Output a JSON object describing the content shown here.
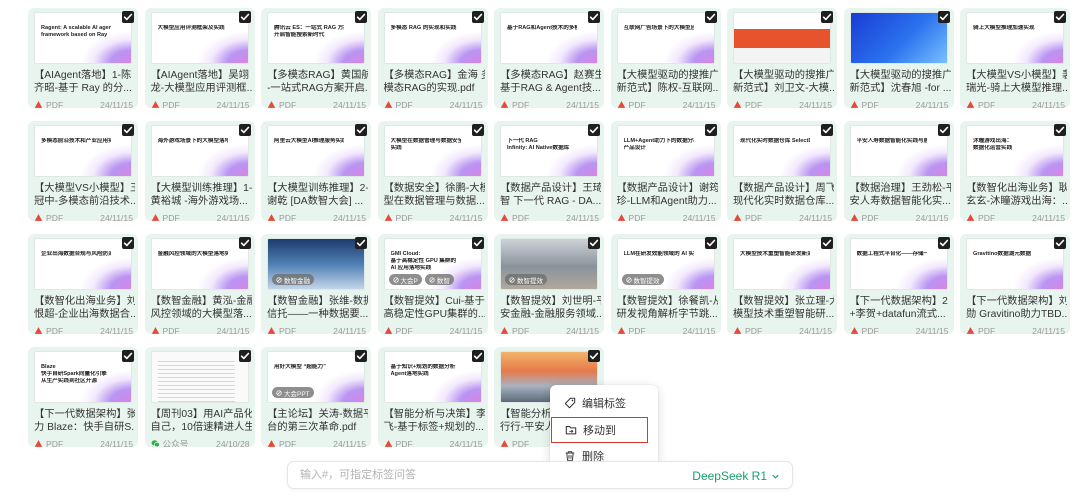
{
  "cards": [
    {
      "lines": [
        "【AIAgent落地】1-陈",
        "齐昭-基于 Ray 的分..."
      ],
      "source": "PDF",
      "source_icon": "pdf-icon",
      "date": "24/11/15",
      "thumb": {
        "tone": "slide",
        "text": [
          "Ragent: A scalable AI agent",
          "framework based on Ray"
        ],
        "tags": []
      }
    },
    {
      "lines": [
        "【AIAgent落地】吴翊",
        "龙-大模型应用评测框..."
      ],
      "source": "PDF",
      "source_icon": "pdf-icon",
      "date": "24/11/15",
      "thumb": {
        "tone": "slide",
        "text": [
          "大模型应用评测框架及实践"
        ],
        "tags": []
      }
    },
    {
      "lines": [
        "【多模态RAG】黄国航",
        "-一站式RAG方案开启..."
      ],
      "source": "PDF",
      "source_icon": "pdf-icon",
      "date": "24/11/15",
      "thumb": {
        "tone": "slide",
        "text": [
          "腾讯云 ES：一站式 RAG 方案",
          "开启智能搜索新时代"
        ],
        "tags": []
      }
    },
    {
      "lines": [
        "【多模态RAG】金海 多",
        "模态RAG的实现.pdf"
      ],
      "source": "PDF",
      "source_icon": "pdf-icon",
      "date": "24/11/15",
      "thumb": {
        "tone": "slide",
        "text": [
          "多模态 RAG 的实现和实践"
        ],
        "tags": []
      }
    },
    {
      "lines": [
        "【多模态RAG】赵赛生",
        "基于RAG & Agent技..."
      ],
      "source": "PDF",
      "source_icon": "pdf-icon",
      "date": "24/11/15",
      "thumb": {
        "tone": "slide",
        "text": [
          "基于RAG和Agent技术的多模态助手实践"
        ],
        "tags": []
      }
    },
    {
      "lines": [
        "【大模型驱动的搜推广",
        "新范式】陈权-互联网..."
      ],
      "source": "PDF",
      "source_icon": "pdf-icon",
      "date": "24/11/15",
      "thumb": {
        "tone": "slide",
        "text": [
          "互联网广告场景下的大模型应用探索与实践"
        ],
        "tags": []
      }
    },
    {
      "lines": [
        "【大模型驱动的搜推广",
        "新范式】刘卫文-大模..."
      ],
      "source": "PDF",
      "source_icon": "pdf-icon",
      "date": "24/11/15",
      "thumb": {
        "tone": "red",
        "text": [],
        "tags": []
      }
    },
    {
      "lines": [
        "【大模型驱动的搜推广",
        "新范式】沈春旭 -for ..."
      ],
      "source": "PDF",
      "source_icon": "pdf-icon",
      "date": "24/11/15",
      "thumb": {
        "tone": "blue",
        "text": [],
        "tags": []
      }
    },
    {
      "lines": [
        "【大模型VS小模型】裴",
        "瑞光-骑上大模型推理..."
      ],
      "source": "PDF",
      "source_icon": "pdf-icon",
      "date": "24/11/15",
      "thumb": {
        "tone": "slide",
        "text": [
          "骑上大模型推理加速实现"
        ],
        "tags": []
      }
    },
    {
      "lines": [
        "【大模型VS小模型】王",
        "冠中-多模态前沿技术..."
      ],
      "source": "PDF",
      "source_icon": "pdf-icon",
      "date": "24/11/15",
      "thumb": {
        "tone": "slide",
        "text": [
          "多模态前沿技术和产业应用实践"
        ],
        "tags": []
      }
    },
    {
      "lines": [
        "【大模型训练推理】1-",
        "黄裕城 -海外游戏场..."
      ],
      "source": "PDF",
      "source_icon": "pdf-icon",
      "date": "24/11/15",
      "thumb": {
        "tone": "slide",
        "text": [
          "海外游戏场景下的大模型落地实践"
        ],
        "tags": []
      }
    },
    {
      "lines": [
        "【大模型训练推理】2-",
        "谢乾 [DA数智大会] ..."
      ],
      "source": "PDF",
      "source_icon": "pdf-icon",
      "date": "24/11/15",
      "thumb": {
        "tone": "slide",
        "text": [
          "阿里云大模型AI推理服务实践"
        ],
        "tags": []
      }
    },
    {
      "lines": [
        "【数据安全】徐鹏-大模",
        "型在数据管理与数据..."
      ],
      "source": "PDF",
      "source_icon": "pdf-icon",
      "date": "24/11/15",
      "thumb": {
        "tone": "slide",
        "text": [
          "大模型在数据管理与数据安全领域的",
          "实践"
        ],
        "tags": []
      }
    },
    {
      "lines": [
        "【数据产品设计】王琦",
        "智 下一代 RAG - DA..."
      ],
      "source": "PDF",
      "source_icon": "pdf-icon",
      "date": "24/11/15",
      "thumb": {
        "tone": "slide",
        "text": [
          "下一代 RAG",
          "Infinity: AI Native数据库"
        ],
        "tags": []
      }
    },
    {
      "lines": [
        "【数据产品设计】谢筠",
        "珍-LLM和Agent助力..."
      ],
      "source": "PDF",
      "source_icon": "pdf-icon",
      "date": "24/11/15",
      "thumb": {
        "tone": "slide",
        "text": [
          "LLM+Agent助力下的数据分析",
          "产品设计"
        ],
        "tags": []
      }
    },
    {
      "lines": [
        "【数据产品设计】周飞-",
        "现代化实时数据仓库..."
      ],
      "source": "PDF",
      "source_icon": "pdf-icon",
      "date": "24/11/15",
      "thumb": {
        "tone": "slide",
        "text": [
          "现代化实时数据仓库 SelectDB"
        ],
        "tags": []
      }
    },
    {
      "lines": [
        "【数据治理】王劲松-平",
        "安人寿数据智能化实..."
      ],
      "source": "PDF",
      "source_icon": "pdf-icon",
      "date": "24/11/15",
      "thumb": {
        "tone": "slide",
        "text": [
          "平安人寿数据智能化实践与展望"
        ],
        "tags": []
      }
    },
    {
      "lines": [
        "【数智化出海业务】耿",
        "玄玄-沐瞳游戏出海：..."
      ],
      "source": "PDF",
      "source_icon": "pdf-icon",
      "date": "24/11/15",
      "thumb": {
        "tone": "slide",
        "text": [
          "沐瞳游戏出海：",
          "数据化运营实践"
        ],
        "tags": []
      }
    },
    {
      "lines": [
        "【数智化出海业务】刘",
        "恨超-企业出海数据合..."
      ],
      "source": "PDF",
      "source_icon": "pdf-icon",
      "date": "24/11/15",
      "thumb": {
        "tone": "slide",
        "text": [
          "企业出海数据合规与风险防范"
        ],
        "tags": []
      }
    },
    {
      "lines": [
        "【数智金融】黄泓-金融",
        "风控领域的大模型落..."
      ],
      "source": "PDF",
      "source_icon": "pdf-icon",
      "date": "24/11/15",
      "thumb": {
        "tone": "slide",
        "text": [
          "金融风控领域的大模型落地实践"
        ],
        "tags": []
      }
    },
    {
      "lines": [
        "【数智金融】张维-数据",
        "信托——一种数据要..."
      ],
      "source": "PDF",
      "source_icon": "pdf-icon",
      "date": "24/11/15",
      "thumb": {
        "tone": "city",
        "text": [],
        "tags": [
          "数智金融"
        ]
      }
    },
    {
      "lines": [
        "【数智提效】Cui-基于",
        "高稳定性GPU集群的..."
      ],
      "source": "PDF",
      "source_icon": "pdf-icon",
      "date": "24/11/15",
      "thumb": {
        "tone": "slide",
        "text": [
          "GMI Cloud:",
          "基于高稳定性 GPU 集群的",
          "AI 应用落地实践"
        ],
        "tags": [
          "大会P",
          "数智"
        ]
      }
    },
    {
      "lines": [
        "【数智提效】刘世明-平",
        "安金融-金融服务领域..."
      ],
      "source": "PDF",
      "source_icon": "pdf-icon",
      "date": "24/11/15",
      "thumb": {
        "tone": "factory",
        "text": [],
        "tags": [
          "数智提效"
        ]
      }
    },
    {
      "lines": [
        "【数智提效】徐餐凯-从",
        "研发视角解析字节跳..."
      ],
      "source": "PDF",
      "source_icon": "pdf-icon",
      "date": "24/11/15",
      "thumb": {
        "tone": "slide",
        "text": [
          "LLM在研发效能领域的 AI 实践"
        ],
        "tags": [
          "数智提效"
        ]
      }
    },
    {
      "lines": [
        "【数智提效】张立理-大",
        "模型技术重塑智能研..."
      ],
      "source": "PDF",
      "source_icon": "pdf-icon",
      "date": "24/11/15",
      "thumb": {
        "tone": "slide",
        "text": [
          "大模型技术重塑智能研发新范式"
        ],
        "tags": []
      }
    },
    {
      "lines": [
        "【下一代数据架构】2",
        "+李贺+datafun流式..."
      ],
      "source": "PDF",
      "source_icon": "pdf-icon",
      "date": "24/11/15",
      "thumb": {
        "tone": "slide",
        "text": [
          "数据工程式平台化——存储一体化"
        ],
        "tags": []
      }
    },
    {
      "lines": [
        "【下一代数据架构】刘",
        "勋 Gravitino助力TBD..."
      ],
      "source": "PDF",
      "source_icon": "pdf-icon",
      "date": "24/11/15",
      "thumb": {
        "tone": "slide",
        "text": [
          "Gravitino数据湖元数据"
        ],
        "tags": []
      }
    },
    {
      "lines": [
        "【下一代数据架构】张",
        "力 Blaze：快手自研S..."
      ],
      "source": "PDF",
      "source_icon": "pdf-icon",
      "date": "24/11/15",
      "thumb": {
        "tone": "slide",
        "text": [
          "Blaze",
          "快手自研Spark向量化引擎",
          "从生产实践到社区开源"
        ],
        "tags": []
      }
    },
    {
      "lines": [
        "【周刊03】用AI产品化",
        "自己，10倍速精进人生"
      ],
      "source": "公众号",
      "source_icon": "wechat-icon",
      "date": "24/10/28",
      "thumb": {
        "tone": "doc",
        "text": [],
        "tags": []
      }
    },
    {
      "lines": [
        "【主论坛】关涛-数据平",
        "台的第三次革命.pdf"
      ],
      "source": "PDF",
      "source_icon": "pdf-icon",
      "date": "24/11/15",
      "thumb": {
        "tone": "slide",
        "text": [
          "用好大模型 “超能力”"
        ],
        "tags": [
          "大会PPT"
        ]
      }
    },
    {
      "lines": [
        "【智能分析与决策】李",
        "飞-基于标签+规划的..."
      ],
      "source": "PDF",
      "source_icon": "pdf-icon",
      "date": "24/11/15",
      "thumb": {
        "tone": "slide",
        "text": [
          "基于知识+规划的数据分析",
          "Agent落地实践"
        ],
        "tags": []
      }
    },
    {
      "lines": [
        "【智能分析与",
        "行行-平安人寿"
      ],
      "source": "PDF",
      "source_icon": "pdf-icon",
      "date": "24/11/15",
      "thumb": {
        "tone": "sunset",
        "text": [],
        "tags": []
      }
    }
  ],
  "menu": {
    "items": [
      {
        "label": "编辑标签",
        "icon": "tag-icon"
      },
      {
        "label": "移动到",
        "icon": "folder-move-icon"
      },
      {
        "label": "删除",
        "icon": "trash-icon"
      }
    ]
  },
  "chat": {
    "placeholder": "输入#，可指定标签问答",
    "model": "DeepSeek R1"
  },
  "colors": {
    "card_bg": "#e8f5ee",
    "pdf": "#e8483a",
    "wechat": "#2bb24c",
    "accent": "#17a06b",
    "highlight_border": "#d9362c"
  }
}
